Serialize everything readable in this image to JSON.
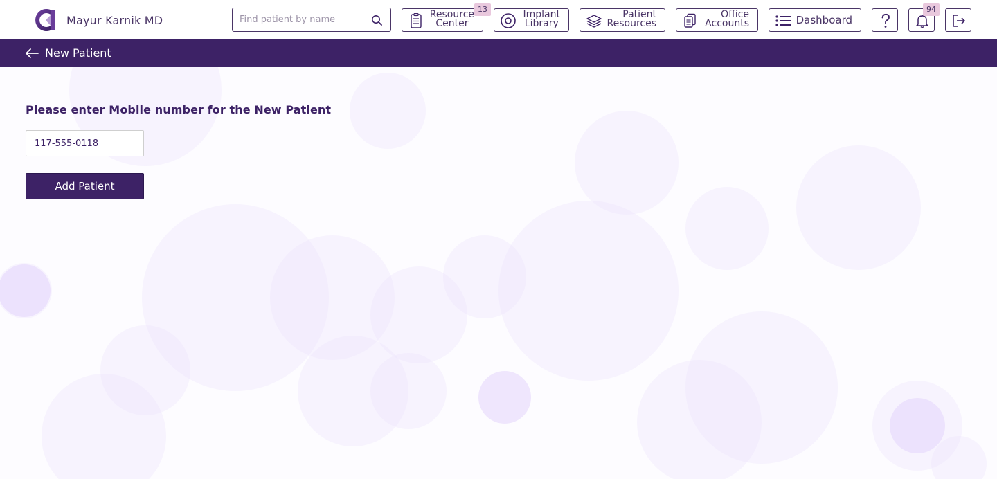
{
  "header": {
    "user_name": "Mayur Karnik MD",
    "search": {
      "placeholder": "Find patient by name",
      "value": ""
    },
    "nav": {
      "resource_center": {
        "line1": "Resource",
        "line2": "Center",
        "badge": "13",
        "icon": "clipboard-icon"
      },
      "implant_library": {
        "line1": "Implant",
        "line2": "Library",
        "icon": "disc-icon"
      },
      "patient_resources": {
        "line1": "Patient",
        "line2": "Resources",
        "icon": "layers-icon"
      },
      "office_accounts": {
        "line1": "Office",
        "line2": "Accounts",
        "icon": "documents-icon"
      },
      "dashboard": {
        "label": "Dashboard",
        "icon": "list-icon"
      }
    },
    "help_icon": "question-icon",
    "notifications": {
      "badge": "94",
      "icon": "bell-icon"
    },
    "logout_icon": "logout-icon"
  },
  "subheader": {
    "title": "New Patient",
    "back_icon": "arrow-left-icon"
  },
  "main": {
    "prompt": "Please enter Mobile number for the New Patient",
    "mobile_input": {
      "value": "117-555-0118"
    },
    "add_button": "Add Patient"
  },
  "colors": {
    "primary": "#3d2266",
    "badge": "#e9c8dd",
    "bubble": "#ece3fb"
  }
}
